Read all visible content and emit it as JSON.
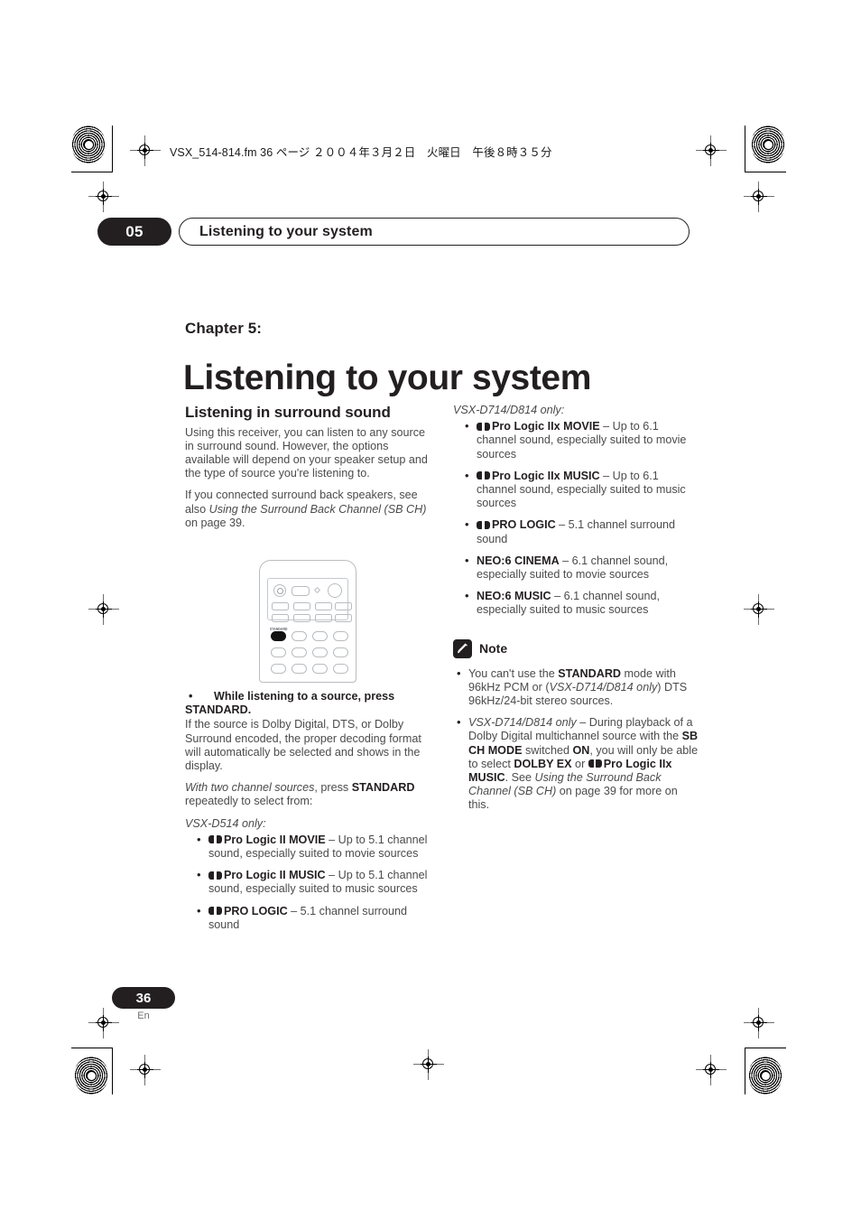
{
  "print_header": {
    "text": "VSX_514-814.fm  36 ページ  ２００４年３月２日　火曜日　午後８時３５分"
  },
  "running_header": {
    "chapter_number": "05",
    "title": "Listening to your system"
  },
  "title_block": {
    "chapter_label": "Chapter 5:",
    "chapter_title": "Listening to your system"
  },
  "left_column": {
    "section_title": "Listening in surround sound",
    "intro_paragraph": "Using this receiver, you can listen to any source in surround sound. However, the options available will depend on your speaker setup and the type of source you're listening to.",
    "surround_back_paragraph_pre": "If you connected surround back speakers, see also ",
    "surround_back_italic": "Using the Surround Back Channel (SB CH)",
    "surround_back_paragraph_post": " on page 39.",
    "instruction_bullet": "•",
    "instruction_line1": "While listening to a source, press",
    "instruction_line2": "STANDARD.",
    "decoding_paragraph": "If the source is Dolby Digital, DTS, or Dolby Surround encoded, the proper decoding format will automatically be selected and shows in the display.",
    "two_channel_italic": "With two channel sources",
    "two_channel_mid": ", press ",
    "two_channel_bold": "STANDARD",
    "two_channel_post": " repeatedly to select from:",
    "model_note": "VSX-D514 only:",
    "modes": [
      {
        "dolby": true,
        "name": "Pro Logic II MOVIE",
        "description": " – Up to 5.1 channel sound, especially suited to movie sources"
      },
      {
        "dolby": true,
        "name": "Pro Logic II MUSIC",
        "description": " – Up to 5.1 channel sound, especially suited to music sources"
      },
      {
        "dolby": true,
        "name": "PRO LOGIC",
        "description": " – 5.1 channel surround sound"
      }
    ]
  },
  "right_column": {
    "model_note": "VSX-D714/D814 only:",
    "modes": [
      {
        "dolby": true,
        "name": "Pro Logic IIx MOVIE",
        "description": " – Up to 6.1 channel sound, especially suited to movie sources"
      },
      {
        "dolby": true,
        "name": "Pro Logic IIx MUSIC",
        "description": " – Up to 6.1 channel sound, especially suited to music sources"
      },
      {
        "dolby": true,
        "name": "PRO LOGIC",
        "description": " – 5.1 channel surround sound"
      },
      {
        "dolby": false,
        "name": "NEO:6 CINEMA",
        "description": " – 6.1 channel sound, especially suited to movie sources"
      },
      {
        "dolby": false,
        "name": "NEO:6 MUSIC",
        "description": " – 6.1 channel sound, especially suited to music sources"
      }
    ],
    "note": {
      "label": "Note",
      "icon": "pencil-icon",
      "items": [
        {
          "p1": "You can't use the ",
          "b1": "STANDARD",
          "p2": " mode with 96kHz PCM or (",
          "i1": "VSX-D714/D814 only",
          "p3": ") DTS 96kHz/24-bit stereo sources."
        },
        {
          "i1": "VSX-D714/D814 only",
          "p1": " – During playback of a Dolby Digital multichannel source with the ",
          "b1": "SB CH MODE",
          "p2": " switched ",
          "b2": "ON",
          "p3": ", you will only be able to select ",
          "b3": "DOLBY EX",
          "p4": " or ",
          "b4": "Pro Logic IIx MUSIC",
          "p5": ". See ",
          "i2": "Using the Surround Back Channel (SB CH)",
          "p6": " on page 39 for more on this."
        }
      ]
    }
  },
  "remote": {
    "standard_button_label": "STANDARD"
  },
  "footer": {
    "page_number": "36",
    "language": "En"
  },
  "colors": {
    "ink": "#231f20",
    "body_text": "#4b4b4b",
    "line_art": "#b9bcc0"
  }
}
